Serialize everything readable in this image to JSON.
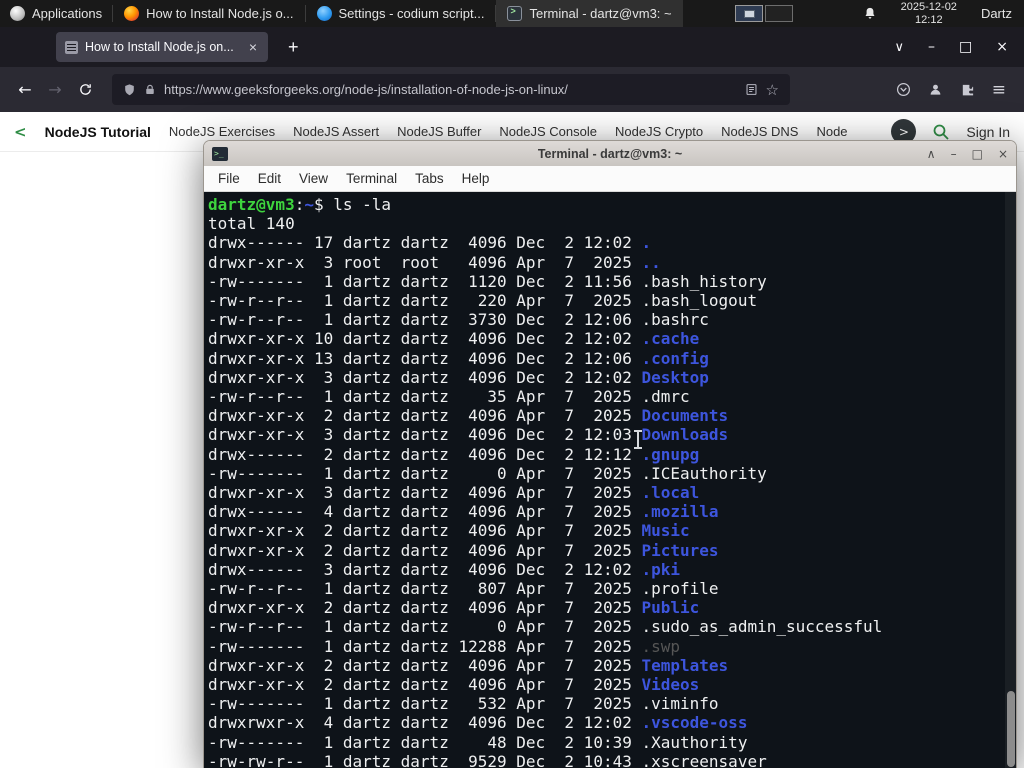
{
  "system_bar": {
    "applications": "Applications",
    "tasks": [
      {
        "title": "How to Install Node.js o...",
        "icon": "firefox-icon"
      },
      {
        "title": "Settings - codium script...",
        "icon": "codium-icon"
      },
      {
        "title": "Terminal - dartz@vm3: ~",
        "icon": "terminal-icon"
      }
    ],
    "clock_date": "2025-12-02",
    "clock_time": "12:12",
    "user": "Dartz"
  },
  "browser": {
    "tab": {
      "title": "How to Install Node.js on...",
      "close": "×"
    },
    "new_tab": "+",
    "window_controls": {
      "list_tabs": "∨",
      "minimize": "–",
      "maximize": "□",
      "close": "×"
    },
    "toolbar": {
      "back": "←",
      "forward": "→",
      "url": "https://www.geeksforgeeks.org/node-js/installation-of-node-js-on-linux/",
      "bookmark_star": "☆",
      "menu": "≡"
    }
  },
  "site_nav": {
    "back_chevron": "<",
    "active": "NodeJS Tutorial",
    "links": [
      "NodeJS Exercises",
      "NodeJS Assert",
      "NodeJS Buffer",
      "NodeJS Console",
      "NodeJS Crypto",
      "NodeJS DNS",
      "Node"
    ],
    "scroll_right": ">",
    "sign_in": "Sign In",
    "accent_green": "#2f8d46"
  },
  "terminal": {
    "title": "Terminal - dartz@vm3: ~",
    "menus": [
      "File",
      "Edit",
      "View",
      "Terminal",
      "Tabs",
      "Help"
    ],
    "window_controls": {
      "rollup": "∧",
      "minimize": "–",
      "maximize": "□",
      "close": "×"
    },
    "colors": {
      "background": "#0e1319",
      "foreground": "#eff0f1",
      "prompt_green": "#3ed43e",
      "dir_blue": "#3d55dd",
      "dim": "#565656"
    },
    "prompt": {
      "user_host": "dartz@vm3",
      "colon": ":",
      "path": "~",
      "dollar": "$ ",
      "command": "ls -la"
    },
    "total": "total 140",
    "listing": [
      {
        "pre": "drwx------ 17 dartz dartz  4096 Dec  2 12:02 ",
        "name": ".",
        "type": "dir"
      },
      {
        "pre": "drwxr-xr-x  3 root  root   4096 Apr  7  2025 ",
        "name": "..",
        "type": "dir"
      },
      {
        "pre": "-rw-------  1 dartz dartz  1120 Dec  2 11:56 ",
        "name": ".bash_history",
        "type": "file"
      },
      {
        "pre": "-rw-r--r--  1 dartz dartz   220 Apr  7  2025 ",
        "name": ".bash_logout",
        "type": "file"
      },
      {
        "pre": "-rw-r--r--  1 dartz dartz  3730 Dec  2 12:06 ",
        "name": ".bashrc",
        "type": "file"
      },
      {
        "pre": "drwxr-xr-x 10 dartz dartz  4096 Dec  2 12:02 ",
        "name": ".cache",
        "type": "dir"
      },
      {
        "pre": "drwxr-xr-x 13 dartz dartz  4096 Dec  2 12:06 ",
        "name": ".config",
        "type": "dir"
      },
      {
        "pre": "drwxr-xr-x  3 dartz dartz  4096 Dec  2 12:02 ",
        "name": "Desktop",
        "type": "dir"
      },
      {
        "pre": "-rw-r--r--  1 dartz dartz    35 Apr  7  2025 ",
        "name": ".dmrc",
        "type": "file"
      },
      {
        "pre": "drwxr-xr-x  2 dartz dartz  4096 Apr  7  2025 ",
        "name": "Documents",
        "type": "dir"
      },
      {
        "pre": "drwxr-xr-x  3 dartz dartz  4096 Dec  2 12:03 ",
        "name": "Downloads",
        "type": "dir"
      },
      {
        "pre": "drwx------  2 dartz dartz  4096 Dec  2 12:12 ",
        "name": ".gnupg",
        "type": "dir"
      },
      {
        "pre": "-rw-------  1 dartz dartz     0 Apr  7  2025 ",
        "name": ".ICEauthority",
        "type": "file"
      },
      {
        "pre": "drwxr-xr-x  3 dartz dartz  4096 Apr  7  2025 ",
        "name": ".local",
        "type": "dir"
      },
      {
        "pre": "drwx------  4 dartz dartz  4096 Apr  7  2025 ",
        "name": ".mozilla",
        "type": "dir"
      },
      {
        "pre": "drwxr-xr-x  2 dartz dartz  4096 Apr  7  2025 ",
        "name": "Music",
        "type": "dir"
      },
      {
        "pre": "drwxr-xr-x  2 dartz dartz  4096 Apr  7  2025 ",
        "name": "Pictures",
        "type": "dir"
      },
      {
        "pre": "drwx------  3 dartz dartz  4096 Dec  2 12:02 ",
        "name": ".pki",
        "type": "dir"
      },
      {
        "pre": "-rw-r--r--  1 dartz dartz   807 Apr  7  2025 ",
        "name": ".profile",
        "type": "file"
      },
      {
        "pre": "drwxr-xr-x  2 dartz dartz  4096 Apr  7  2025 ",
        "name": "Public",
        "type": "dir"
      },
      {
        "pre": "-rw-r--r--  1 dartz dartz     0 Apr  7  2025 ",
        "name": ".sudo_as_admin_successful",
        "type": "file"
      },
      {
        "pre": "-rw-------  1 dartz dartz 12288 Apr  7  2025 ",
        "name": ".swp",
        "type": "dim"
      },
      {
        "pre": "drwxr-xr-x  2 dartz dartz  4096 Apr  7  2025 ",
        "name": "Templates",
        "type": "dir"
      },
      {
        "pre": "drwxr-xr-x  2 dartz dartz  4096 Apr  7  2025 ",
        "name": "Videos",
        "type": "dir"
      },
      {
        "pre": "-rw-------  1 dartz dartz   532 Apr  7  2025 ",
        "name": ".viminfo",
        "type": "file"
      },
      {
        "pre": "drwxrwxr-x  4 dartz dartz  4096 Dec  2 12:02 ",
        "name": ".vscode-oss",
        "type": "dir"
      },
      {
        "pre": "-rw-------  1 dartz dartz    48 Dec  2 10:39 ",
        "name": ".Xauthority",
        "type": "file"
      },
      {
        "pre": "-rw-rw-r--  1 dartz dartz  9529 Dec  2 10:43 ",
        "name": ".xscreensaver",
        "type": "file"
      }
    ]
  }
}
